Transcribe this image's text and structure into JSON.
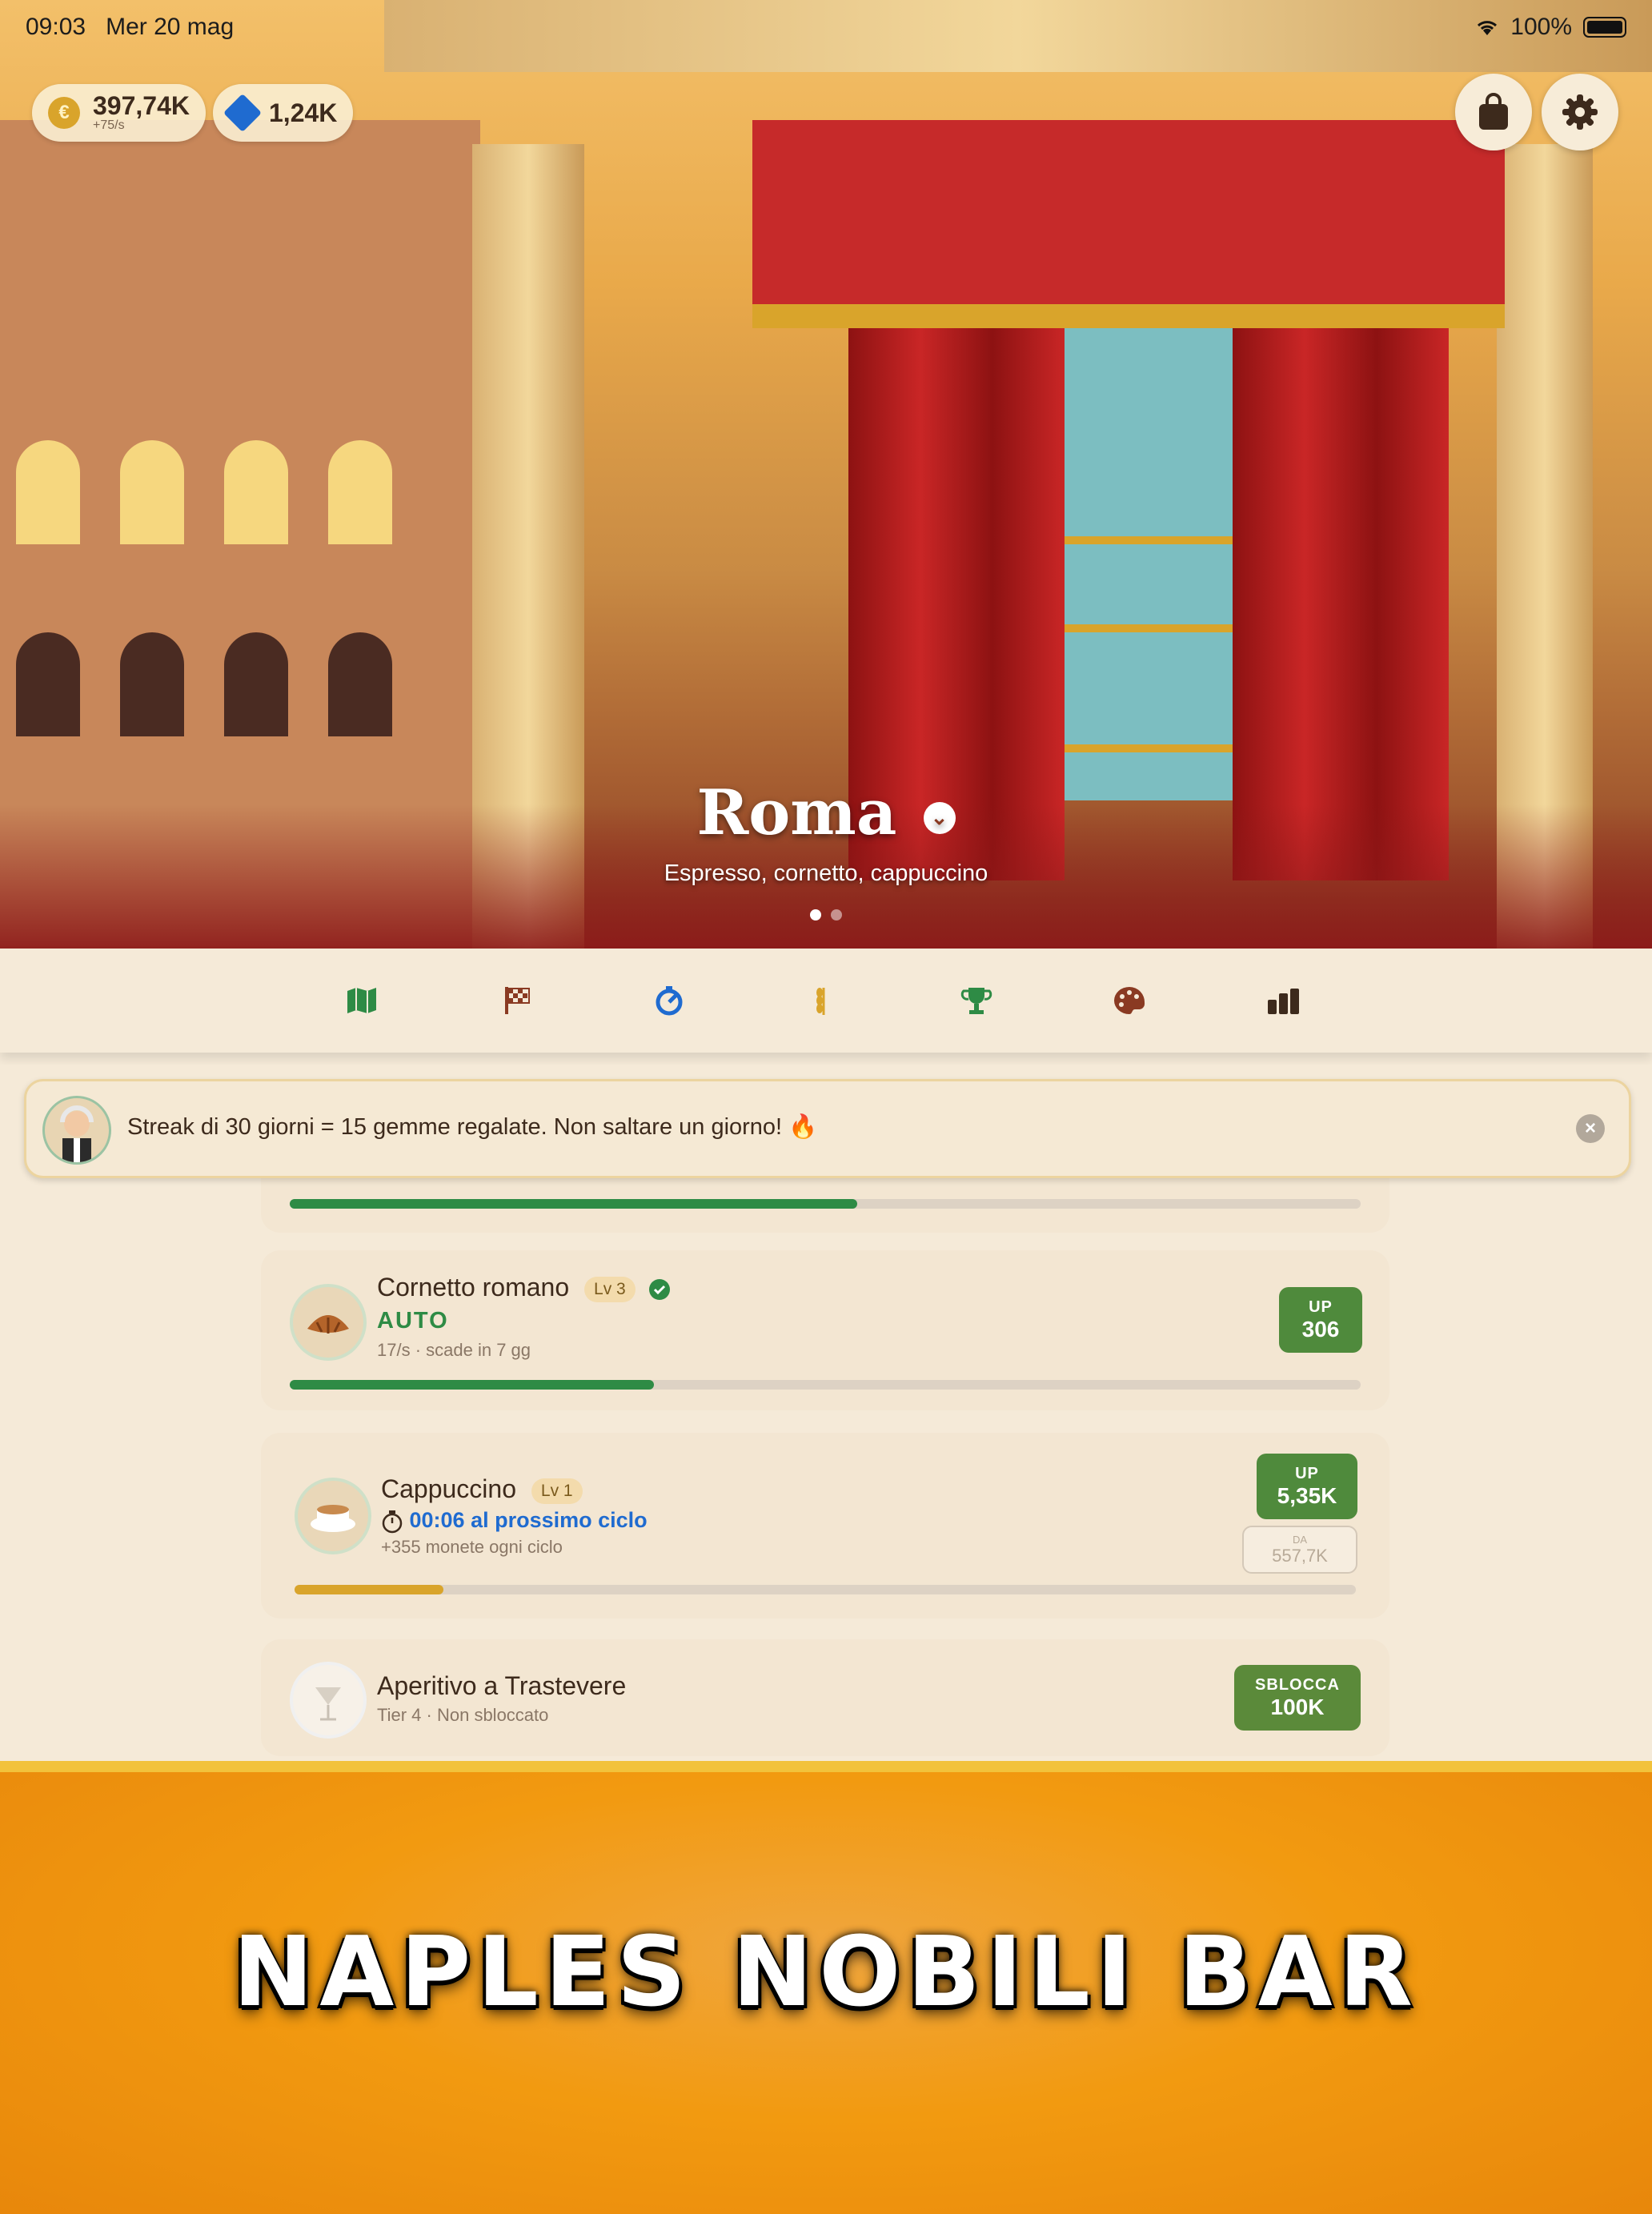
{
  "status_bar": {
    "time": "09:03",
    "date": "Mer 20 mag",
    "battery": "100%"
  },
  "currency": {
    "coins": "397,74K",
    "coin_rate": "+75/s",
    "coin_symbol": "€",
    "gems": "1,24K"
  },
  "hero": {
    "city": "Roma",
    "subtitle": "Espresso, cornetto, cappuccino",
    "page_index": 1,
    "page_count": 2
  },
  "tabs": [
    {
      "icon": "map-icon",
      "color": "#2e8b45"
    },
    {
      "icon": "checkered-flag-icon",
      "color": "#8a3a22"
    },
    {
      "icon": "gauge-icon",
      "color": "#1f6bd0"
    },
    {
      "icon": "wheat-icon",
      "color": "#d9a42b"
    },
    {
      "icon": "trophy-icon",
      "color": "#2e8b45"
    },
    {
      "icon": "palette-icon",
      "color": "#8a3a22"
    },
    {
      "icon": "bar-chart-icon",
      "color": "#3d2a1c"
    }
  ],
  "toast": {
    "text": "Streak di 30 giorni = 15 gemme regalate. Non saltare un giorno! 🔥"
  },
  "items": [
    {
      "progress": 0.53
    },
    {
      "name": "Cornetto romano",
      "level": "Lv 3",
      "verified": true,
      "status": "AUTO",
      "meta": "17/s  ·  scade in 7 gg",
      "up_label": "UP",
      "up_cost": "306",
      "progress": 0.34
    },
    {
      "name": "Cappuccino",
      "level": "Lv 1",
      "timer": "00:06 al prossimo ciclo",
      "meta": "+355 monete ogni ciclo",
      "up_label": "UP",
      "up_cost": "5,35K",
      "manager_label": "DA",
      "manager_cost": "557,7K",
      "progress": 0.14
    },
    {
      "name": "Aperitivo a Trastevere",
      "meta": "Tier 4 · Non sbloccato",
      "unlock_label": "SBLOCCA",
      "unlock_cost": "100K"
    }
  ],
  "colors": {
    "accent_green": "#4f8a3c",
    "progress_green": "#2e8b45",
    "progress_gold": "#d9a42b",
    "timer_blue": "#1f6bd0",
    "banner_orange": "#f29a10"
  },
  "banner": {
    "title": "NAPLES NOBILI BAR"
  }
}
